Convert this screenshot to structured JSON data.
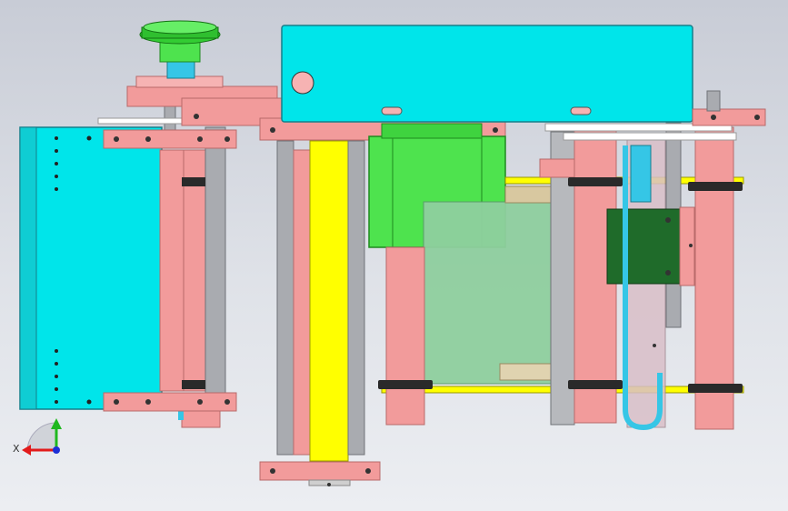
{
  "viewport": {
    "background_top": "#c8ccd6",
    "background_bottom": "#eceef2"
  },
  "palette": {
    "cyan": "#00e5ea",
    "pink": "#f29b9b",
    "pink_dark": "#d97c7c",
    "gray_rod": "#a9abb0",
    "yellow": "#ffff00",
    "green": "#4ee34e",
    "dark_green": "#1f6b2a",
    "glass": "#8fcf9f",
    "black_clamp": "#2a2a2a",
    "tube_blue": "#35c6e6"
  },
  "triad": {
    "x_label": "X",
    "x_color": "#e21b1b",
    "y_color": "#1fb81f",
    "z_color": "#1d2fd6"
  }
}
